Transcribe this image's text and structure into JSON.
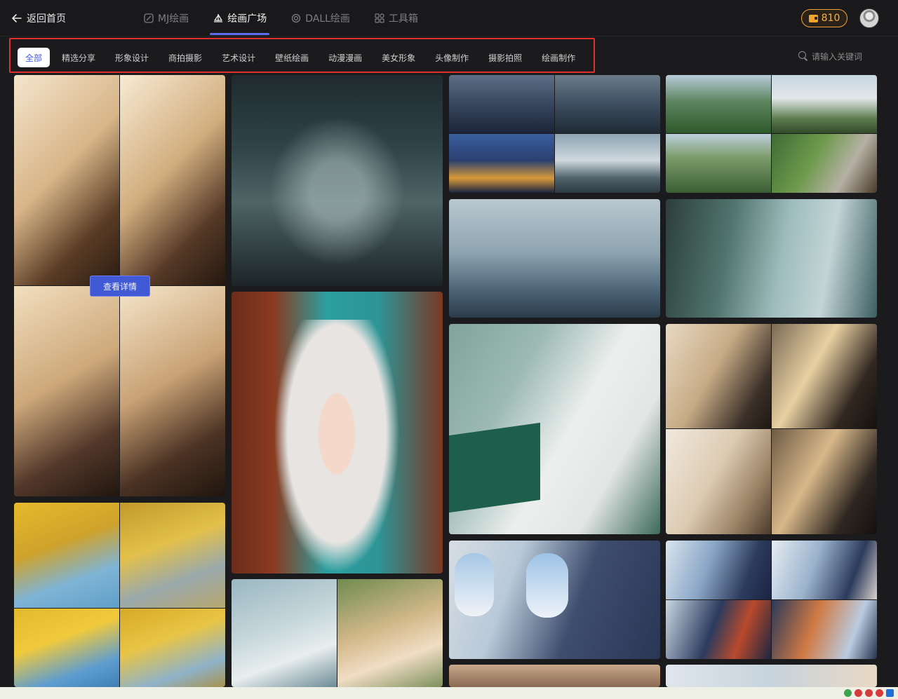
{
  "header": {
    "back_label": "返回首页",
    "tabs": [
      {
        "label": "MJ绘画",
        "icon": "mj-icon",
        "active": false
      },
      {
        "label": "绘画广场",
        "icon": "sailboat-icon",
        "active": true
      },
      {
        "label": "DALL绘画",
        "icon": "openai-icon",
        "active": false
      },
      {
        "label": "工具箱",
        "icon": "grid-icon",
        "active": false
      }
    ],
    "coins": "810"
  },
  "categories": [
    "全部",
    "精选分享",
    "形象设计",
    "商拍摄影",
    "艺术设计",
    "壁纸绘画",
    "动漫漫画",
    "美女形象",
    "头像制作",
    "摄影拍照",
    "绘画制作"
  ],
  "active_category": "全部",
  "search": {
    "placeholder": "请输入关键词"
  },
  "gallery": {
    "detail_button": "查看详情"
  },
  "colors": {
    "accent": "#5b6cf0",
    "highlight_border": "#e0302d",
    "coin": "#f4b347"
  }
}
